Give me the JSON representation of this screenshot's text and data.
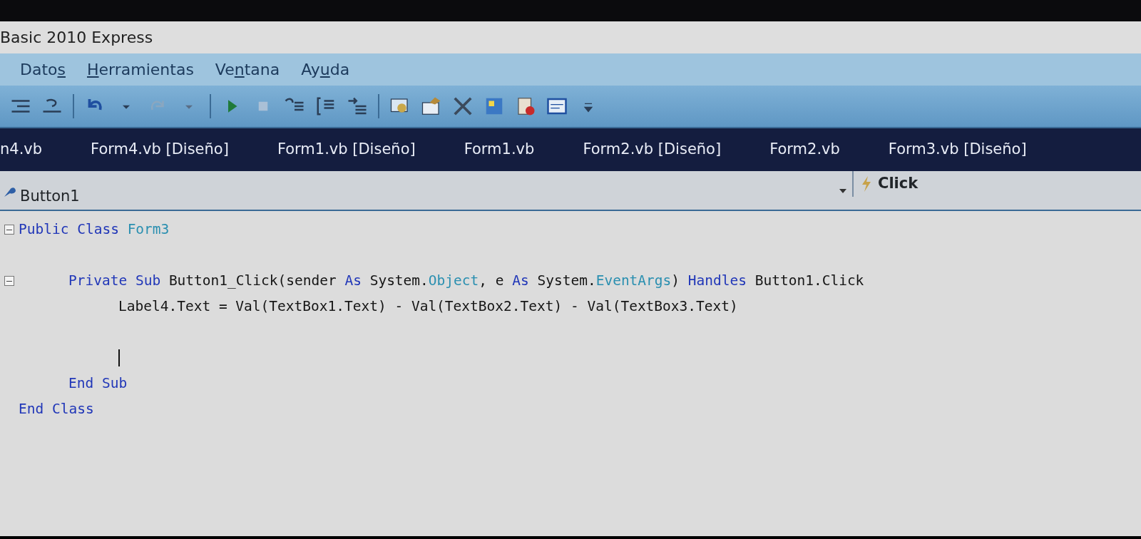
{
  "window": {
    "title": "Basic 2010 Express"
  },
  "menu": [
    {
      "parts": [
        {
          "text": "Dato"
        },
        {
          "text": "s",
          "mnemonic": true
        }
      ]
    },
    {
      "parts": [
        {
          "text": "H",
          "mnemonic": true
        },
        {
          "text": "erramientas"
        }
      ]
    },
    {
      "parts": [
        {
          "text": "Ve"
        },
        {
          "text": "n",
          "mnemonic": true
        },
        {
          "text": "tana"
        }
      ]
    },
    {
      "parts": [
        {
          "text": "Ay"
        },
        {
          "text": "u",
          "mnemonic": true
        },
        {
          "text": "da"
        }
      ]
    }
  ],
  "tabs": [
    {
      "label": "n4.vb",
      "selected": false
    },
    {
      "label": "Form4.vb [Diseño]",
      "selected": false
    },
    {
      "label": "Form1.vb [Diseño]",
      "selected": false
    },
    {
      "label": "Form1.vb",
      "selected": false
    },
    {
      "label": "Form2.vb [Diseño]",
      "selected": false
    },
    {
      "label": "Form2.vb",
      "selected": false
    },
    {
      "label": "Form3.vb [Diseño]",
      "selected": false
    }
  ],
  "navigation": {
    "object": "Button1",
    "event": "Click"
  },
  "code": [
    {
      "kind": "code",
      "expanded": true,
      "tokens": [
        {
          "text": "Public Class",
          "kind": "keyword"
        },
        {
          "text": " Form3",
          "kind": "type"
        }
      ],
      "children": [
        {
          "kind": "blank"
        },
        {
          "kind": "code",
          "expanded": true,
          "tokens": [
            {
              "text": "Private Sub",
              "kind": "keyword"
            },
            {
              "text": " Button1_Click(sender ",
              "kind": "plain"
            },
            {
              "text": "As",
              "kind": "keyword"
            },
            {
              "text": " System.",
              "kind": "plain"
            },
            {
              "text": "Object",
              "kind": "type"
            },
            {
              "text": ", e ",
              "kind": "plain"
            },
            {
              "text": "As",
              "kind": "keyword"
            },
            {
              "text": " System.",
              "kind": "plain"
            },
            {
              "text": "EventArgs",
              "kind": "type"
            },
            {
              "text": ") ",
              "kind": "plain"
            },
            {
              "text": "Handles",
              "kind": "keyword"
            },
            {
              "text": " Button1.Click",
              "kind": "plain"
            }
          ],
          "children": [
            {
              "kind": "code",
              "tokens": [
                {
                  "text": "Label4.Text = Val(TextBox1.Text) - Val(TextBox2.Text) - Val(TextBox3.Text)",
                  "kind": "plain"
                }
              ]
            },
            {
              "kind": "blank"
            },
            {
              "kind": "blank",
              "caret": true
            }
          ]
        },
        {
          "kind": "code",
          "tokens": [
            {
              "text": "End Sub",
              "kind": "keyword"
            }
          ]
        }
      ]
    },
    {
      "kind": "code",
      "tokens": [
        {
          "text": "End Class",
          "kind": "keyword"
        }
      ]
    }
  ]
}
